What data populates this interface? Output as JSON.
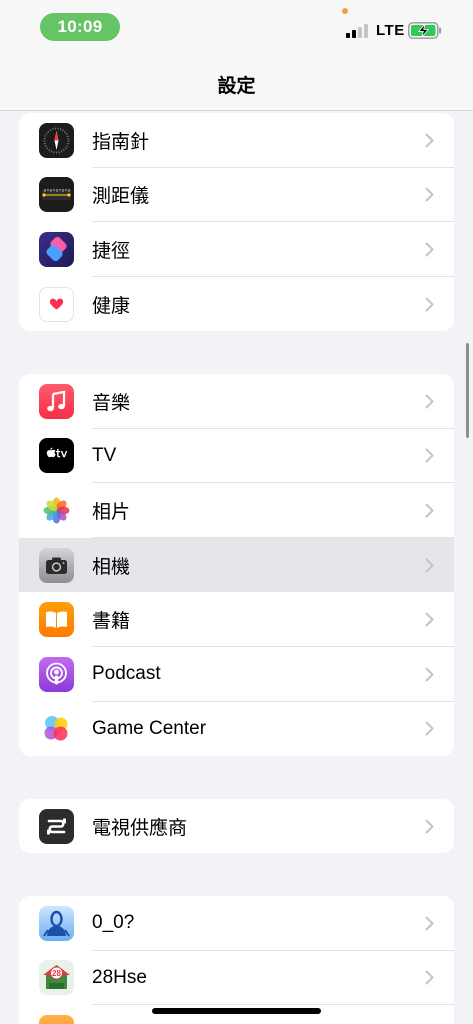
{
  "status": {
    "time": "10:09",
    "network": "LTE"
  },
  "nav": {
    "title": "設定"
  },
  "groups": [
    {
      "items": [
        {
          "label": "指南針",
          "icon": "compass-icon"
        },
        {
          "label": "測距儀",
          "icon": "measure-icon"
        },
        {
          "label": "捷徑",
          "icon": "shortcuts-icon"
        },
        {
          "label": "健康",
          "icon": "health-icon"
        }
      ]
    },
    {
      "items": [
        {
          "label": "音樂",
          "icon": "music-icon"
        },
        {
          "label": "TV",
          "icon": "tv-icon"
        },
        {
          "label": "相片",
          "icon": "photos-icon"
        },
        {
          "label": "相機",
          "icon": "camera-icon",
          "highlighted": true
        },
        {
          "label": "書籍",
          "icon": "books-icon"
        },
        {
          "label": "Podcast",
          "icon": "podcast-icon"
        },
        {
          "label": "Game Center",
          "icon": "game-center-icon"
        }
      ]
    },
    {
      "items": [
        {
          "label": "電視供應商",
          "icon": "tv-provider-icon"
        }
      ]
    },
    {
      "items": [
        {
          "label": "0_0?",
          "icon": "app-0-0-icon"
        },
        {
          "label": "28Hse",
          "icon": "app-28hse-icon",
          "icon_text": "28"
        },
        {
          "label": "",
          "icon": "app-partial-icon"
        }
      ]
    }
  ]
}
